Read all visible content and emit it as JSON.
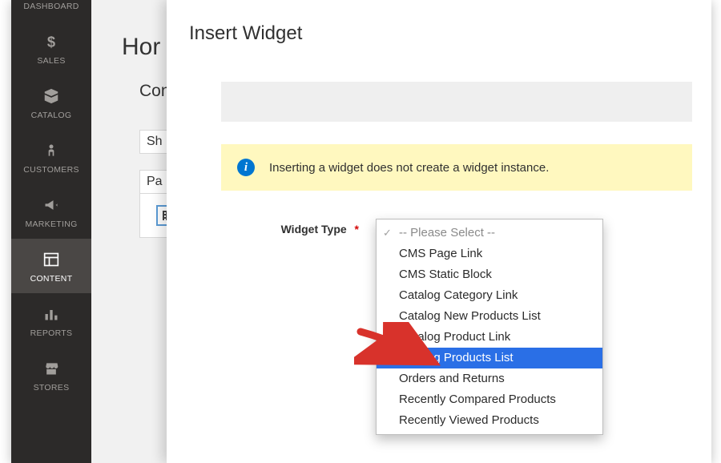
{
  "sidebar": {
    "items": [
      {
        "label": "DASHBOARD",
        "icon": "dashboard"
      },
      {
        "label": "SALES",
        "icon": "dollar"
      },
      {
        "label": "CATALOG",
        "icon": "box"
      },
      {
        "label": "CUSTOMERS",
        "icon": "person"
      },
      {
        "label": "MARKETING",
        "icon": "megaphone"
      },
      {
        "label": "CONTENT",
        "icon": "layout",
        "active": true
      },
      {
        "label": "REPORTS",
        "icon": "bars"
      },
      {
        "label": "STORES",
        "icon": "storefront"
      }
    ]
  },
  "page": {
    "title_truncated": "Hor",
    "section_title_truncated": "Con",
    "row1_label_truncated": "Sh",
    "row2_label_truncated": "Pa"
  },
  "modal": {
    "title": "Insert Widget",
    "notice": "Inserting a widget does not create a widget instance.",
    "field_label": "Widget Type",
    "dropdown": {
      "placeholder": "-- Please Select --",
      "options": [
        "CMS Page Link",
        "CMS Static Block",
        "Catalog Category Link",
        "Catalog New Products List",
        "Catalog Product Link",
        "Catalog Products List",
        "Orders and Returns",
        "Recently Compared Products",
        "Recently Viewed Products"
      ],
      "highlighted": "Catalog Products List"
    }
  }
}
